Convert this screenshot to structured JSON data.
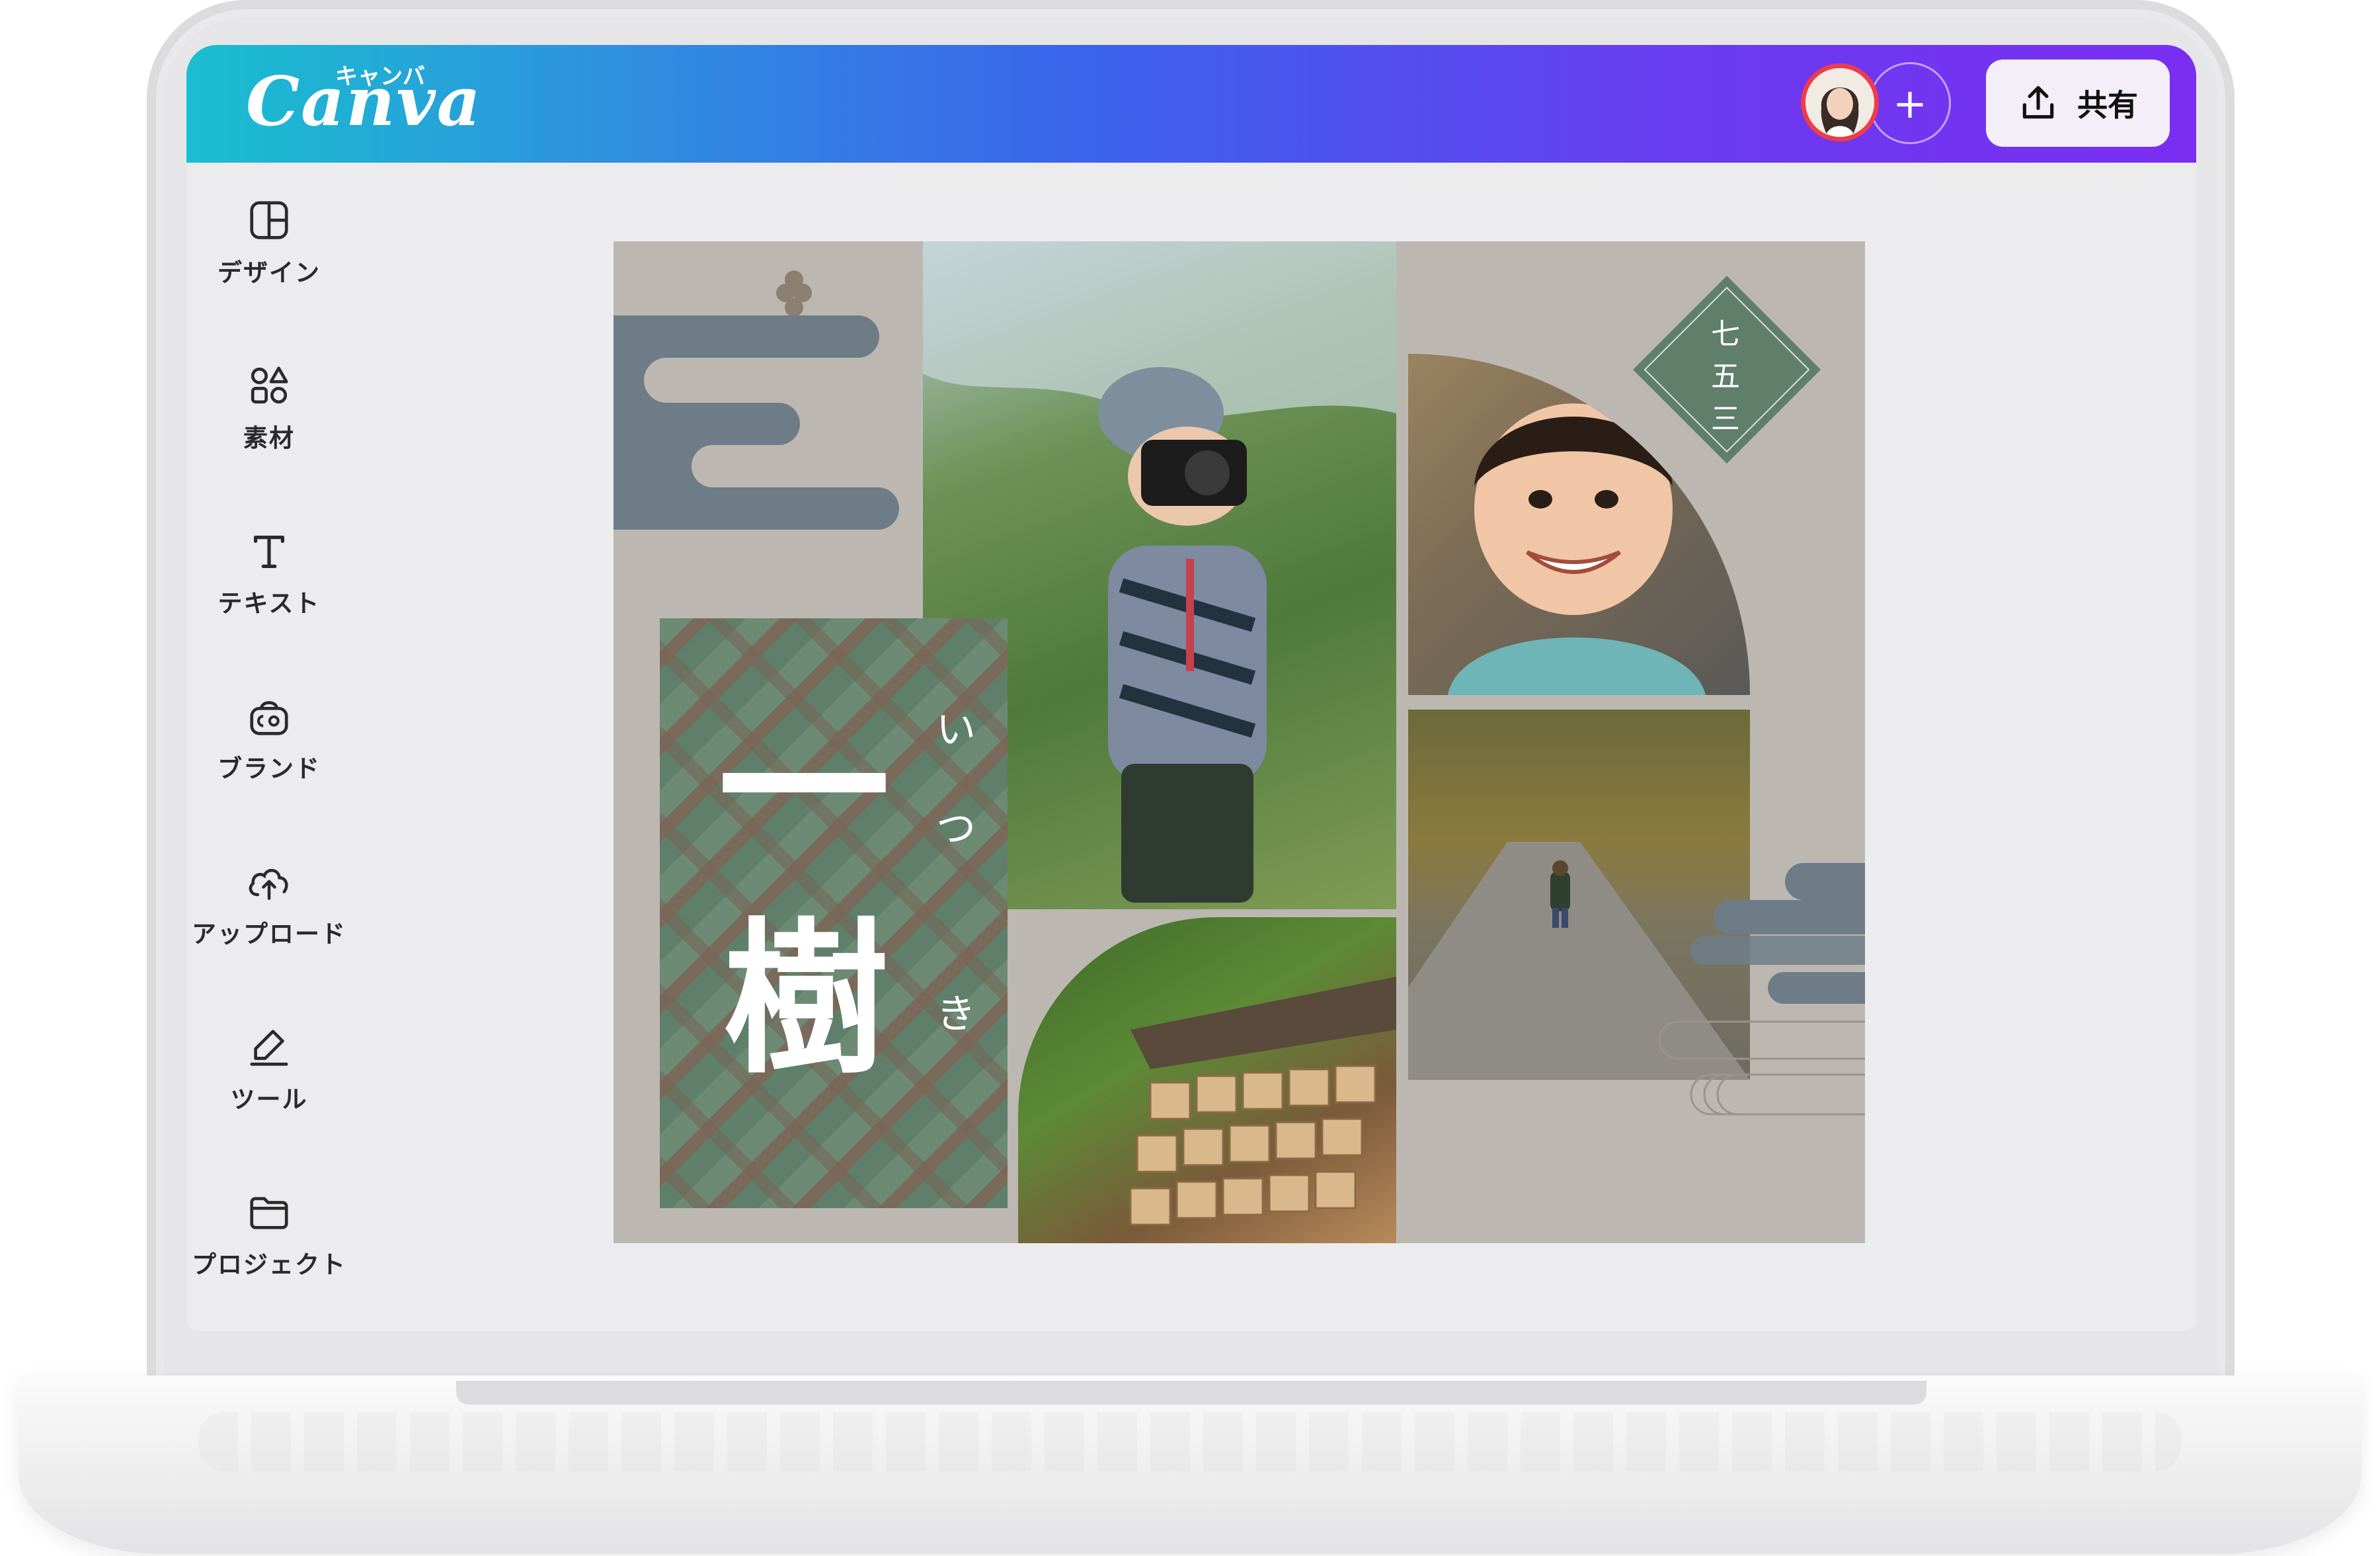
{
  "app": {
    "logo_text": "Canva",
    "logo_kana": "キャンバ",
    "share_label": "共有",
    "add_collaborator": "+"
  },
  "sidebar": {
    "items": [
      {
        "label": "デザイン",
        "icon": "layout-icon"
      },
      {
        "label": "素材",
        "icon": "elements-icon"
      },
      {
        "label": "テキスト",
        "icon": "text-icon"
      },
      {
        "label": "ブランド",
        "icon": "brand-icon"
      },
      {
        "label": "アップロード",
        "icon": "cloud-upload-icon"
      },
      {
        "label": "ツール",
        "icon": "draw-tool-icon"
      },
      {
        "label": "プロジェクト",
        "icon": "folder-icon"
      }
    ]
  },
  "design": {
    "name_main_1": "一",
    "name_main_2": "樹",
    "furigana_1": "い",
    "furigana_2": "つ",
    "furigana_3": "き",
    "badge_1": "七",
    "badge_2": "五",
    "badge_3": "三"
  },
  "colors": {
    "topbar_start": "#19bfcf",
    "topbar_end": "#7a2ef2",
    "design_bg": "#bcb8b1",
    "slate_cloud": "#6e7c88",
    "badge_green": "#5f7f6a"
  }
}
